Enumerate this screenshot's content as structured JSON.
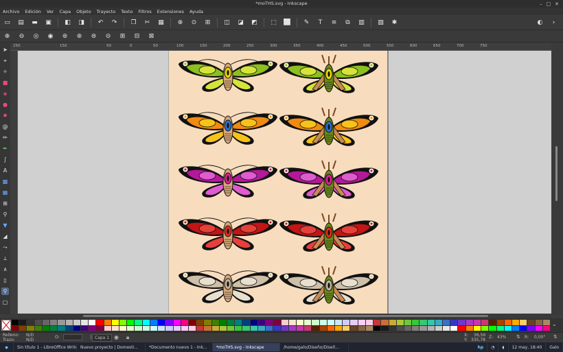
{
  "window": {
    "title": "*moTHS.svg - Inkscape"
  },
  "menu": [
    "Archivo",
    "Edición",
    "Ver",
    "Capa",
    "Objeto",
    "Trayecto",
    "Texto",
    "Filtros",
    "Extensiones",
    "Ayuda"
  ],
  "ruler": {
    "h_labels": [
      "250",
      "200",
      "150",
      "100",
      "50",
      "0",
      "50",
      "100",
      "150",
      "200",
      "250",
      "300",
      "350",
      "400",
      "450",
      "500",
      "550",
      "600",
      "650",
      "700",
      "750"
    ]
  },
  "status": {
    "fill_label": "Relleno:",
    "fill_value": "N/D",
    "stroke_label": "Trazo:",
    "stroke_value": "N/D",
    "opacity_label": "O:",
    "layer": "Capa 1",
    "x_label": "X:",
    "x_value": "36,56",
    "y_label": "Y:",
    "y_value": "335,78",
    "zoom_label": "Z:",
    "zoom_value": "43%",
    "rot_label": "R:",
    "rot_value": "0,00°"
  },
  "taskbar": {
    "items": [
      "Sin título 1 - LibreOffice Writer",
      "Nuevo proyecto | Domesti...",
      "*Documento nuevo 1 - Ink...",
      "*moTHS.svg - Inkscape",
      "/home/galo/Diseño/Diseñ..."
    ],
    "clock": "12 may, 18:40",
    "user": "Galo"
  },
  "colors": {
    "page": "#f7dcbe",
    "canvas": "#d0d0d0"
  }
}
